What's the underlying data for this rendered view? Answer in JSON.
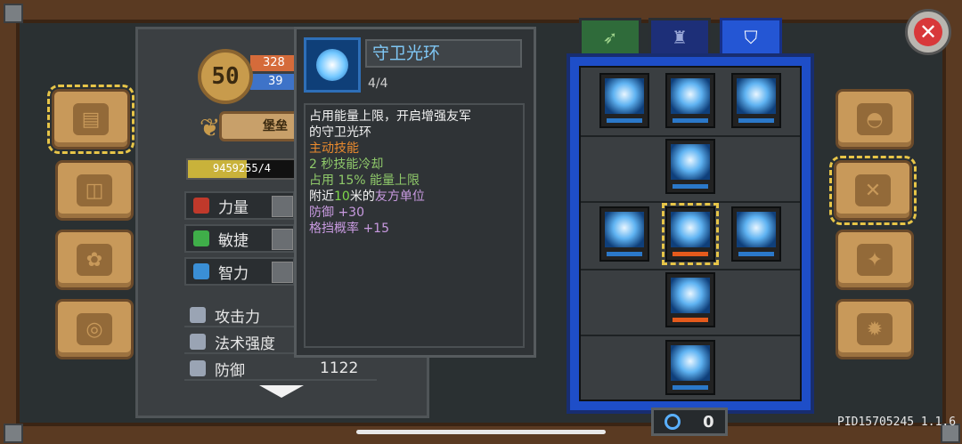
{
  "player": {
    "level": "50",
    "hp": "328",
    "mp": "39",
    "fortress_label": "堡垒",
    "xp_text": "9459255/4",
    "xp_fraction": 0.55
  },
  "attributes": [
    {
      "label": "力量",
      "icon": "fist-icon",
      "color": "#c0392b"
    },
    {
      "label": "敏捷",
      "icon": "feather-icon",
      "color": "#3fae49"
    },
    {
      "label": "智力",
      "icon": "book-icon",
      "color": "#3a8fd6"
    }
  ],
  "combat_stats": [
    {
      "label": "攻击力",
      "value": "",
      "icon": "sword-icon"
    },
    {
      "label": "法术强度",
      "value": "",
      "icon": "wand-icon"
    },
    {
      "label": "防御",
      "value": "1122",
      "icon": "shield-icon"
    }
  ],
  "skill_tooltip": {
    "title": "守卫光环",
    "level": "4/4",
    "desc_line1": "占用能量上限，开启增强友军",
    "desc_line2": "的守卫光环",
    "type": "主动技能",
    "cooldown": "2 秒技能冷却",
    "energy_a": "占用 15% 能量上限",
    "range_a": "附近",
    "range_num": "10",
    "range_b": "米的",
    "range_c": "友方单位",
    "defense": "防御 +30",
    "block": "格挡概率 +15"
  },
  "tabs": [
    {
      "icon": "bow-icon",
      "active": false
    },
    {
      "icon": "castle-icon",
      "active": false
    },
    {
      "icon": "shield-tab-icon",
      "active": true
    }
  ],
  "skill_points": "0",
  "version": "PID15705245 1.1.6",
  "left_menu": [
    "journal-icon",
    "chest-icon",
    "gems-icon",
    "ring-icon"
  ],
  "right_menu": [
    "helmet-icon",
    "swords-icon",
    "compass-icon",
    "gear-icon"
  ]
}
